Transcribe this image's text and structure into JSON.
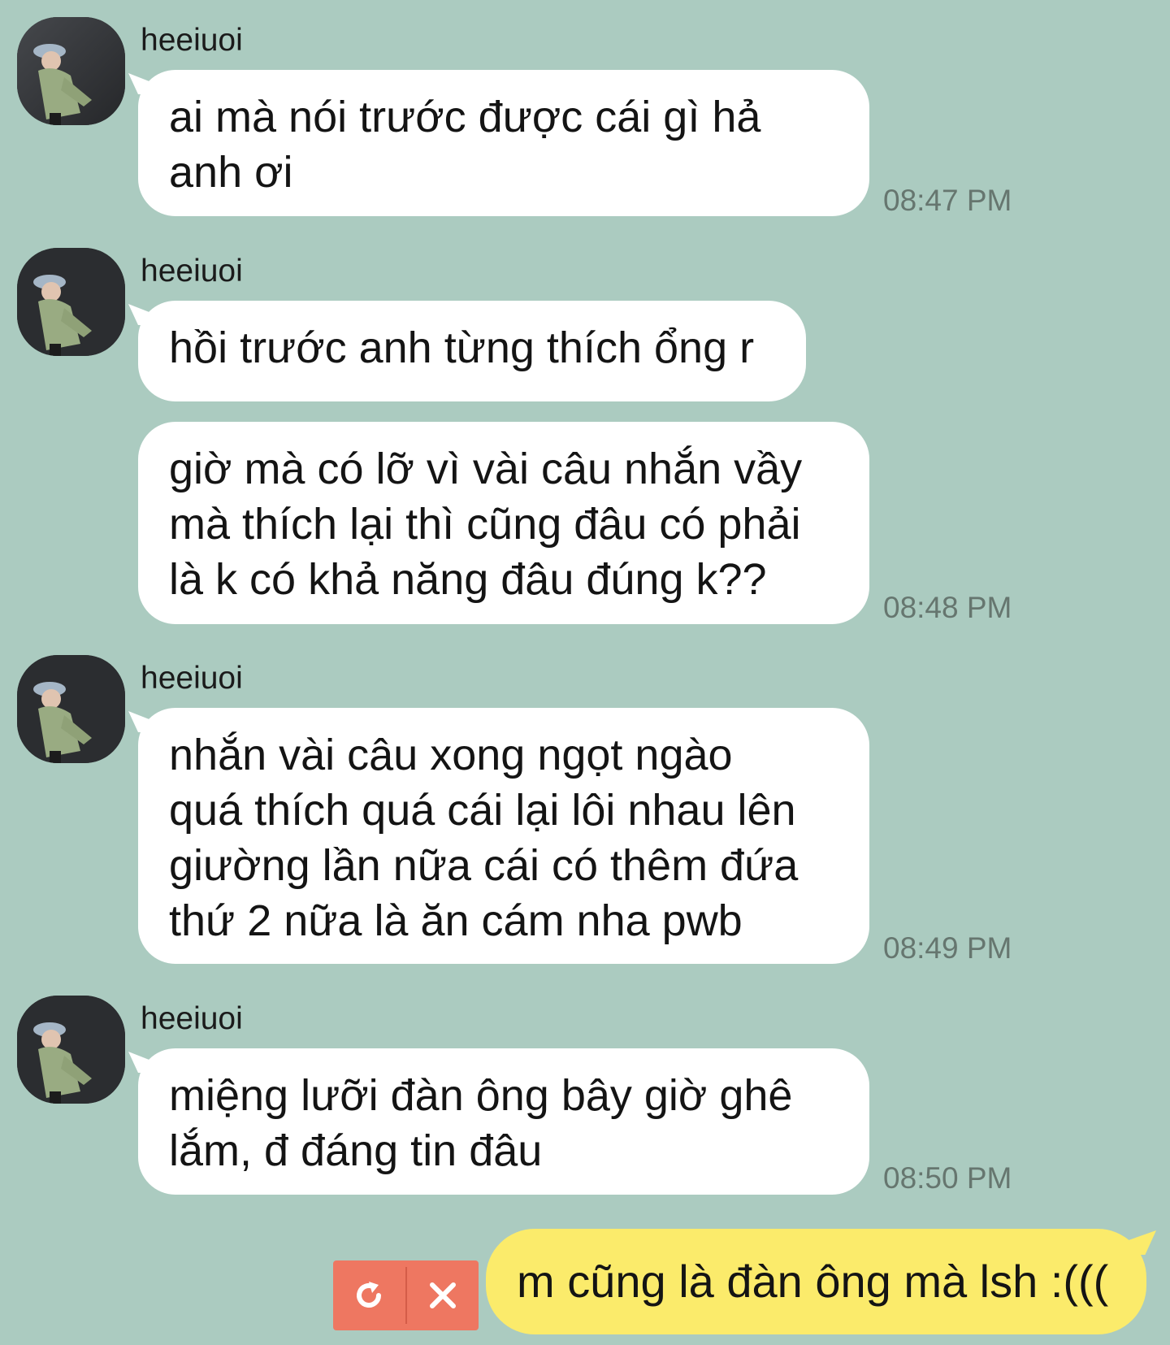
{
  "messages": [
    {
      "sender": "heeiuoi",
      "bubbles": [
        {
          "lines": [
            "ai mà nói trước được cái gì hả",
            "anh ơi"
          ]
        }
      ],
      "time": "08:47 PM"
    },
    {
      "sender": "heeiuoi",
      "bubbles": [
        {
          "lines": [
            "hồi trước anh từng thích ổng r"
          ]
        },
        {
          "lines": [
            "giờ mà có lỡ vì vài câu nhắn vầy",
            "mà thích lại thì cũng đâu có phải",
            "là k có khả năng đâu đúng k??"
          ]
        }
      ],
      "time": "08:48 PM"
    },
    {
      "sender": "heeiuoi",
      "bubbles": [
        {
          "lines": [
            "nhắn vài câu xong ngọt ngào",
            "quá thích quá cái lại lôi nhau lên",
            "giường lần nữa cái có thêm đứa",
            "thứ 2 nữa là ăn cám nha pwb"
          ]
        }
      ],
      "time": "08:49 PM"
    },
    {
      "sender": "heeiuoi",
      "bubbles": [
        {
          "lines": [
            "miệng lưỡi đàn ông bây giờ ghê",
            "lắm, đ đáng tin đâu"
          ]
        }
      ],
      "time": "08:50 PM"
    }
  ],
  "outgoing": {
    "text": "m cũng là đàn ông mà lsh :((("
  },
  "colors": {
    "background": "#abcbc0",
    "incoming_bubble": "#ffffff",
    "outgoing_bubble": "#fbeb6b",
    "failed_actions": "#ee7761",
    "timestamp": "#66766f"
  },
  "icons": {
    "retry": "retry-icon",
    "delete": "close-icon"
  }
}
